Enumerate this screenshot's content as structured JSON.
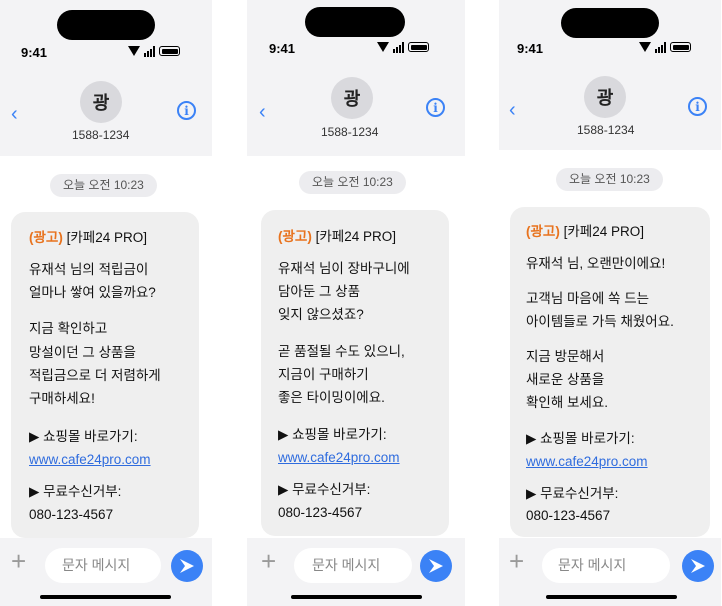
{
  "screens": [
    {
      "time": "9:41",
      "sender_initial": "광",
      "sender_number": "1588-1234",
      "date_divider": "오늘 오전 10:23",
      "ad_tag": "(광고)",
      "brand": "[카페24 PRO]",
      "message_lines": [
        "유재석 님의 적립금이",
        "얼마나 쌓여 있을까요?",
        "지금 확인하고",
        "망설이던 그 상품을",
        "적립금으로 더 저렴하게",
        "구매하세요!"
      ],
      "shop_label": "▶ 쇼핑몰 바로가기:",
      "shop_link": "www.cafe24pro.com",
      "optout_label": "▶ 무료수신거부:",
      "optout_number": "080-123-4567",
      "input_placeholder": "문자 메시지"
    },
    {
      "time": "9:41",
      "sender_initial": "광",
      "sender_number": "1588-1234",
      "date_divider": "오늘 오전 10:23",
      "ad_tag": "(광고)",
      "brand": "[카페24 PRO]",
      "message_lines": [
        "유재석 님이 장바구니에",
        "담아둔 그 상품",
        "잊지 않으셨죠?",
        "곧 품절될 수도 있으니,",
        "지금이 구매하기",
        "좋은 타이밍이에요."
      ],
      "shop_label": "▶ 쇼핑몰 바로가기:",
      "shop_link": "www.cafe24pro.com",
      "optout_label": "▶ 무료수신거부:",
      "optout_number": "080-123-4567",
      "input_placeholder": "문자 메시지"
    },
    {
      "time": "9:41",
      "sender_initial": "광",
      "sender_number": "1588-1234",
      "date_divider": "오늘 오전 10:23",
      "ad_tag": "(광고)",
      "brand": "[카페24 PRO]",
      "message_lines": [
        "유재석 님, 오랜만이에요!",
        "고객님 마음에 쏙 드는",
        "아이템들로 가득 채웠어요.",
        "지금 방문해서",
        "새로운 상품을",
        "확인해 보세요."
      ],
      "shop_label": "▶ 쇼핑몰 바로가기:",
      "shop_link": "www.cafe24pro.com",
      "optout_label": "▶ 무료수신거부:",
      "optout_number": "080-123-4567",
      "input_placeholder": "문자 메시지"
    }
  ],
  "colors": {
    "accent": "#3b82f6",
    "ad_tag": "#e8731e",
    "link": "#2f6cde",
    "bubble": "#efefef",
    "header": "#f3f3f5"
  }
}
